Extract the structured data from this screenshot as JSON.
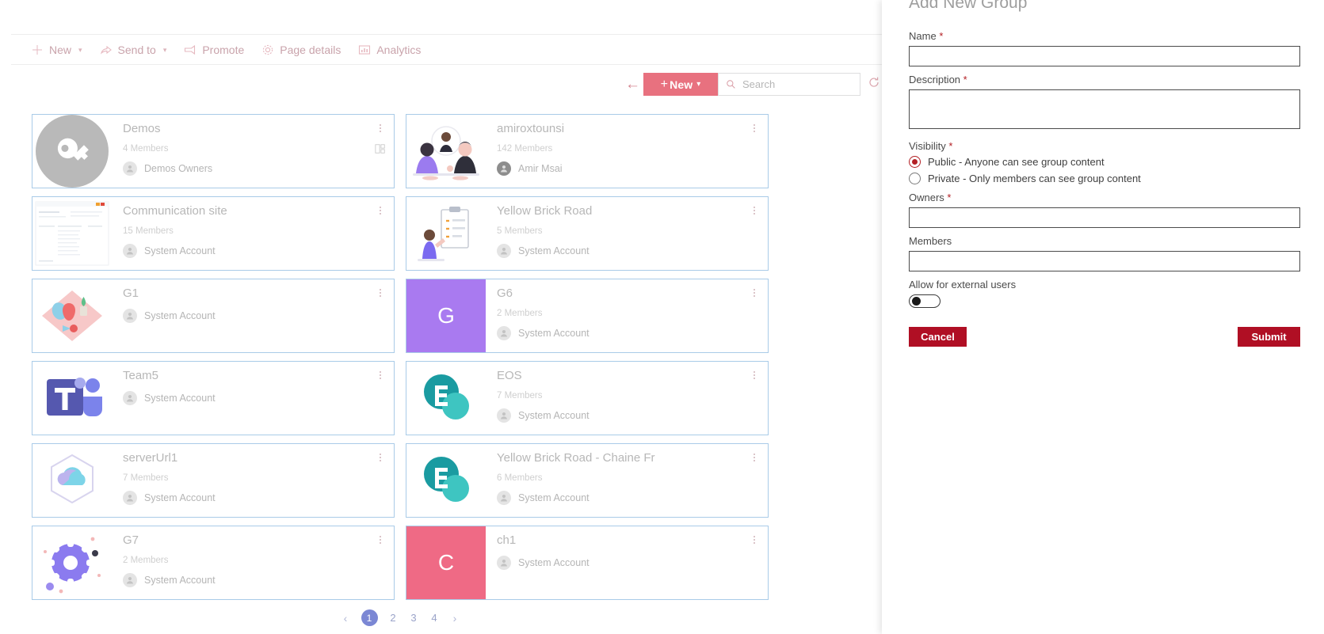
{
  "command_bar": {
    "items": [
      {
        "label": "New",
        "icon": "plus-icon",
        "has_chevron": true
      },
      {
        "label": "Send to",
        "icon": "send-to-icon",
        "has_chevron": true
      },
      {
        "label": "Promote",
        "icon": "promote-icon",
        "has_chevron": false
      },
      {
        "label": "Page details",
        "icon": "gear-icon",
        "has_chevron": false
      },
      {
        "label": "Analytics",
        "icon": "analytics-icon",
        "has_chevron": false
      }
    ]
  },
  "toolbar": {
    "back_icon": "back-arrow-icon",
    "new_label": "New",
    "new_plus": "+",
    "new_chevron": "∨",
    "search_placeholder": "Search",
    "search_value": "",
    "search_icon": "search-icon",
    "refresh_icon": "refresh-icon",
    "new_button_color": "#e8717f"
  },
  "groups": [
    {
      "title": "Demos",
      "members": "4 Members",
      "owner": "Demos Owners",
      "thumb": "key-circle",
      "extra_icon": "site-icon"
    },
    {
      "title": "amiroxtounsi",
      "members": "142 Members",
      "owner": "Amir Msai",
      "thumb": "illustration-meeting"
    },
    {
      "title": "Communication site",
      "members": "15 Members",
      "owner": "System Account",
      "thumb": "illustration-site"
    },
    {
      "title": "Yellow Brick Road",
      "members": "5 Members",
      "owner": "System Account",
      "thumb": "illustration-board"
    },
    {
      "title": "G1",
      "members": "",
      "owner": "System Account",
      "thumb": "illustration-diamond"
    },
    {
      "title": "G6",
      "members": "2 Members",
      "owner": "System Account",
      "thumb": "letter",
      "letter": "G",
      "color": "#a97af0"
    },
    {
      "title": "Team5",
      "members": "",
      "owner": "System Account",
      "thumb": "teams-icon"
    },
    {
      "title": "EOS",
      "members": "7 Members",
      "owner": "System Account",
      "thumb": "sharepoint-icon"
    },
    {
      "title": "serverUrl1",
      "members": "7 Members",
      "owner": "System Account",
      "thumb": "cloud-hex-icon"
    },
    {
      "title": "Yellow Brick Road - Chaine Fr",
      "members": "6 Members",
      "owner": "System Account",
      "thumb": "sharepoint-icon"
    },
    {
      "title": "G7",
      "members": "2 Members",
      "owner": "System Account",
      "thumb": "gear-illustration"
    },
    {
      "title": "ch1",
      "members": "",
      "owner": "System Account",
      "thumb": "letter",
      "letter": "C",
      "color": "#ef6a85"
    }
  ],
  "pagination": {
    "prev": "‹",
    "next": "›",
    "pages": [
      "1",
      "2",
      "3",
      "4"
    ],
    "active": "1",
    "active_color": "#7b87d4"
  },
  "panel": {
    "title": "Add New Group",
    "name": {
      "label": "Name",
      "required": "*",
      "value": "",
      "placeholder": ""
    },
    "description": {
      "label": "Description",
      "required": "*",
      "value": "",
      "placeholder": ""
    },
    "visibility": {
      "label": "Visibility",
      "required": "*",
      "options": [
        {
          "label": "Public - Anyone can see group content",
          "selected": true
        },
        {
          "label": "Private - Only members can see group content",
          "selected": false
        }
      ]
    },
    "owners": {
      "label": "Owners",
      "required": "*",
      "value": "",
      "placeholder": ""
    },
    "members": {
      "label": "Members",
      "required": "",
      "value": "",
      "placeholder": ""
    },
    "external": {
      "label": "Allow for external users",
      "on": false
    },
    "cancel_label": "Cancel",
    "submit_label": "Submit",
    "button_color": "#b00f24"
  }
}
